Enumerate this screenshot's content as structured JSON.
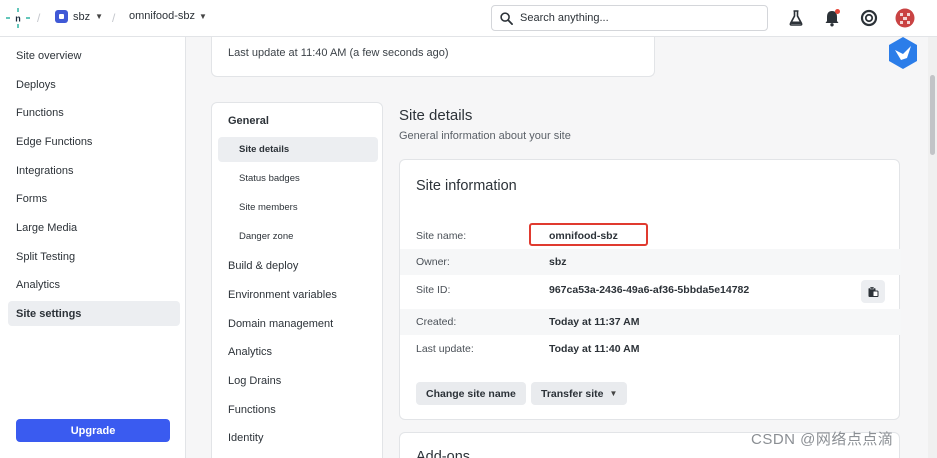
{
  "topbar": {
    "team_name": "sbz",
    "site_name": "omnifood-sbz",
    "search_placeholder": "Search anything..."
  },
  "sidebar": {
    "items": [
      {
        "label": "Site overview"
      },
      {
        "label": "Deploys"
      },
      {
        "label": "Functions"
      },
      {
        "label": "Edge Functions"
      },
      {
        "label": "Integrations"
      },
      {
        "label": "Forms"
      },
      {
        "label": "Large Media"
      },
      {
        "label": "Split Testing"
      },
      {
        "label": "Analytics"
      },
      {
        "label": "Site settings",
        "active": true
      }
    ],
    "upgrade_label": "Upgrade"
  },
  "top_card": {
    "last_update": "Last update at 11:40 AM (a few seconds ago)"
  },
  "settings_nav": {
    "heading": "General",
    "sub_items": [
      {
        "label": "Site details",
        "active": true
      },
      {
        "label": "Status badges"
      },
      {
        "label": "Site members"
      },
      {
        "label": "Danger zone"
      }
    ],
    "items": [
      {
        "label": "Build & deploy"
      },
      {
        "label": "Environment variables"
      },
      {
        "label": "Domain management"
      },
      {
        "label": "Analytics"
      },
      {
        "label": "Log Drains"
      },
      {
        "label": "Functions"
      },
      {
        "label": "Identity"
      }
    ]
  },
  "main": {
    "section_title": "Site details",
    "section_subtitle": "General information about your site",
    "info_card": {
      "title": "Site information",
      "rows": [
        {
          "label": "Site name:",
          "value": "omnifood-sbz"
        },
        {
          "label": "Owner:",
          "value": "sbz"
        },
        {
          "label": "Site ID:",
          "value": "967ca53a-2436-49a6-af36-5bbda5e14782"
        },
        {
          "label": "Created:",
          "value": "Today at 11:37 AM"
        },
        {
          "label": "Last update:",
          "value": "Today at 11:40 AM"
        }
      ],
      "change_name_label": "Change site name",
      "transfer_label": "Transfer site"
    },
    "addons_title": "Add-ons"
  },
  "watermark": "CSDN @网络点点滴",
  "colors": {
    "accent": "#3a5bf0",
    "highlight_border": "#e03a2f",
    "notification_dot": "#e5483b"
  }
}
